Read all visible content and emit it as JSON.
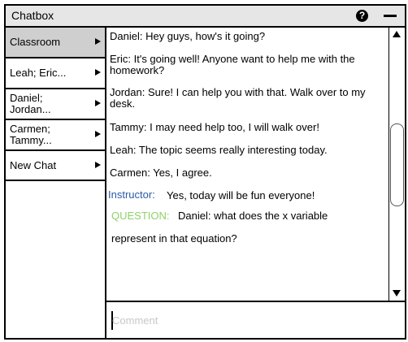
{
  "window": {
    "title": "Chatbox",
    "help_icon": "?",
    "icons": [
      "help-icon",
      "minimize-icon"
    ]
  },
  "sidebar": {
    "items": [
      {
        "label": "Classroom",
        "selected": true
      },
      {
        "label": "Leah; Eric...",
        "selected": false
      },
      {
        "label": "Daniel;\nJordan...",
        "selected": false
      },
      {
        "label": "Carmen;\nTammy...",
        "selected": false
      },
      {
        "label": "New Chat",
        "selected": false
      }
    ]
  },
  "chat": {
    "messages": [
      {
        "text": "Daniel: Hey guys, how's it going?"
      },
      {
        "text": "Eric: It's going well! Anyone want to help me with the homework?"
      },
      {
        "text": "Jordan: Sure! I can help you with that. Walk over to my desk."
      },
      {
        "text": "Tammy: I may need help too, I will walk over!"
      },
      {
        "text": "Leah: The topic seems really interesting today."
      },
      {
        "text": "Carmen: Yes, I agree."
      }
    ],
    "instructor": {
      "tag": "Instructor:",
      "text": "Yes, today will be fun everyone!"
    },
    "question": {
      "tag": "QUESTION:",
      "text": "Daniel: what does the x variable",
      "continuation": "represent in that equation?"
    }
  },
  "composer": {
    "placeholder": "Comment"
  },
  "colors": {
    "titlebar": "#e6e6e6",
    "selected_item": "#cfcfcf",
    "instructor": "#2b5aa6",
    "question": "#8fd16a",
    "placeholder": "#c7c7c7"
  }
}
